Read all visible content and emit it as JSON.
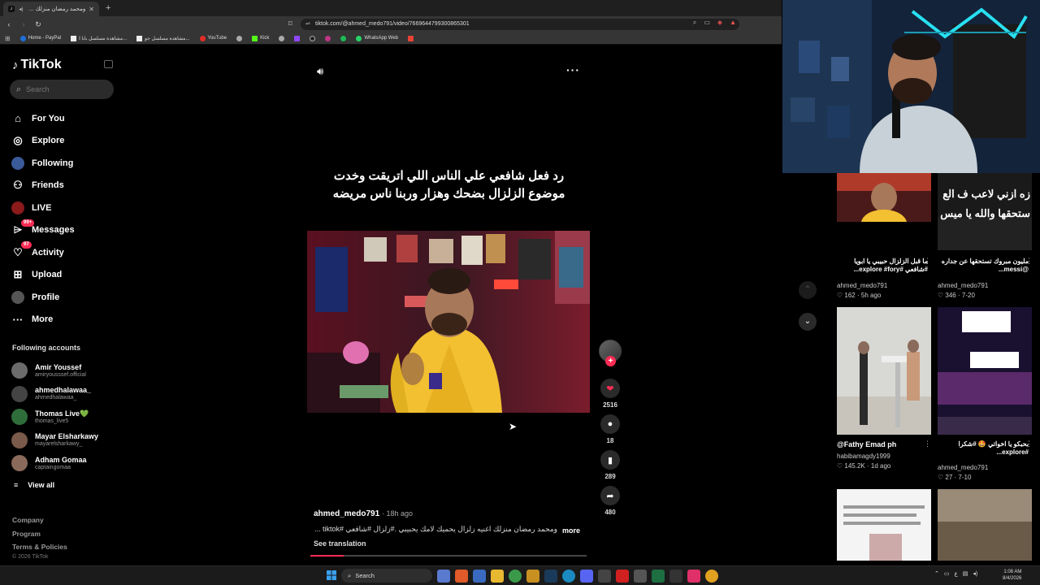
{
  "browser": {
    "tab_title": "ومحمد رمضان منزلك اغنيه زلزال",
    "url": "tiktok.com/@ahmed_medo791/video/7669644799300865301",
    "bookmarks": [
      "Home - PayPal",
      "مشاهدة مسلسل بابا ا...",
      "مشاهدة مسلسل جو...",
      "YouTube",
      "Kick",
      "WhatsApp Web"
    ]
  },
  "sidebar": {
    "logo": "TikTok",
    "search_placeholder": "Search",
    "nav": [
      {
        "label": "For You",
        "icon": "home-icon"
      },
      {
        "label": "Explore",
        "icon": "compass-icon"
      },
      {
        "label": "Following",
        "icon": "following-icon"
      },
      {
        "label": "Friends",
        "icon": "friends-icon"
      },
      {
        "label": "LIVE",
        "icon": "live-icon"
      },
      {
        "label": "Messages",
        "icon": "messages-icon",
        "badge": "99+"
      },
      {
        "label": "Activity",
        "icon": "activity-icon",
        "badge": "97"
      },
      {
        "label": "Upload",
        "icon": "upload-icon"
      },
      {
        "label": "Profile",
        "icon": "profile-icon"
      },
      {
        "label": "More",
        "icon": "more-icon"
      }
    ],
    "following_title": "Following accounts",
    "accounts": [
      {
        "name": "Amir Youssef",
        "handle": "amiryousssef.official"
      },
      {
        "name": "ahmedhalawaa_",
        "handle": "ahmedhalawaa_"
      },
      {
        "name": "Thomas Live💚",
        "handle": "thomas_live5"
      },
      {
        "name": "Mayar Elsharkawy",
        "handle": "mayarelsharkawy_"
      },
      {
        "name": "Adham Gomaa",
        "handle": "captaingomaa"
      }
    ],
    "view_all": "View all",
    "footer": [
      "Company",
      "Program",
      "Terms & Policies"
    ],
    "copyright": "© 2026 TikTok"
  },
  "video": {
    "caption": "رد فعل شافعي علي الناس اللي اتريقت وخدت موضوع الزلزال بضحك وهزار وربنا ناس مريضه",
    "likes": "2516",
    "comments": "18",
    "saves": "289",
    "shares": "480",
    "author": "ahmed_medo791",
    "time_ago": "18h ago",
    "description": "ومحمد رمضان منزلك اغنيه زلزال يحميك لامك يحبيبي .#زلزال #شافعي #tiktok ...",
    "more_label": "more",
    "translation_label": "See translation",
    "progress": 0.12
  },
  "grid": [
    {
      "title": "ما قبل الزلزال حبيبي يا ابويا #شافعي #explore #fory...",
      "author": "ahmed_medo791",
      "likes": "162",
      "age": "5h ago",
      "overlay": ""
    },
    {
      "title": "مليون مبروك تستحقها عن جداره @messi...",
      "author": "ahmed_medo791",
      "likes": "346",
      "age": "7-20",
      "overlay": "زه ازني لاعب ف الع ستحقها والله يا ميس"
    },
    {
      "title": "@Fathy Emad ph",
      "author": "habibamagdy1999",
      "likes": "145.2K",
      "age": "1d ago",
      "overlay": ""
    },
    {
      "title": "بحبكو يا اخواتي 🤩 #شكرا #explore...",
      "author": "ahmed_medo791",
      "likes": "27",
      "age": "7-10",
      "overlay": ""
    }
  ],
  "taskbar": {
    "search": "Search",
    "time": "1:08 AM",
    "date": "8/4/2026"
  },
  "colors": {
    "accent": "#fe2c55",
    "background": "#000000"
  }
}
